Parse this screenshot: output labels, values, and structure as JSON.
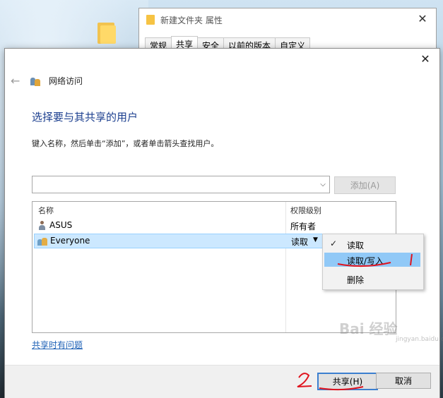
{
  "properties_window": {
    "title": "新建文件夹 属性",
    "tabs": [
      "常规",
      "共享",
      "安全",
      "以前的版本",
      "自定义"
    ],
    "active_tab": "共享"
  },
  "dialog": {
    "nav_title": "网络访问",
    "heading": "选择要与其共享的用户",
    "instruction": "键入名称，然后单击“添加”，或者单击箭头查找用户。",
    "combo_value": "",
    "add_button": "添加(A)",
    "columns": {
      "name": "名称",
      "permission": "权限级别"
    },
    "users": [
      {
        "name": "ASUS",
        "permission": "所有者"
      },
      {
        "name": "Everyone",
        "permission": "读取"
      }
    ],
    "permission_menu": [
      {
        "label": "读取",
        "checked": true
      },
      {
        "label": "读取/写入",
        "highlighted": true
      },
      {
        "label": "删除"
      }
    ],
    "help_link": "共享时有问题",
    "share_button": "共享(H)",
    "cancel_button": "取消"
  },
  "annotations": {
    "mark_1": "1",
    "mark_2": "2"
  },
  "watermark": {
    "main": "Bai 经验",
    "sub": "jingyan.baidu.com"
  },
  "colors": {
    "heading": "#1c3f8f",
    "link": "#1b5fb5",
    "highlight": "#91c9f7",
    "annotation": "#e0141e"
  }
}
